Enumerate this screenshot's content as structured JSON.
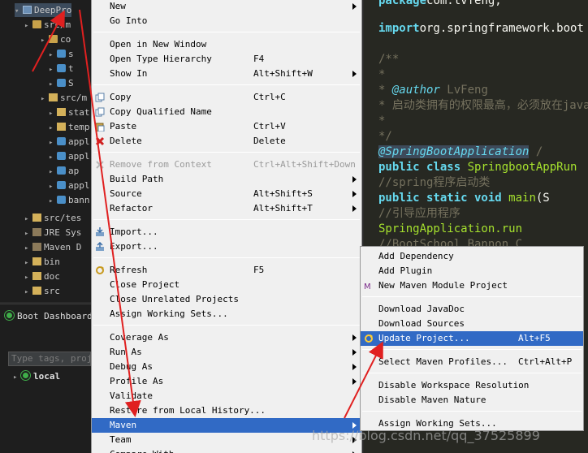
{
  "explorer": {
    "project": "DeepPro",
    "rows": [
      "src/m",
      "co",
      "s",
      "t",
      "S",
      "src/m",
      "stat",
      "temp",
      "appl",
      "appl",
      "ap",
      "appl",
      "bann",
      "src/tes",
      "JRE Sys",
      "Maven D",
      "bin",
      "doc",
      "src"
    ]
  },
  "boot_dashboard": {
    "title": "Boot Dashboard",
    "filter_placeholder": "Type tags, proje",
    "local": "local"
  },
  "editor": {
    "lines": [
      {
        "parts": [
          [
            "kw",
            "package"
          ],
          [
            "",
            "com.lvfeng;"
          ]
        ]
      },
      {
        "parts": [
          [
            "kw",
            "import"
          ],
          [
            "",
            "org.springframework.boot"
          ]
        ]
      },
      {
        "parts": [
          [
            "cm",
            "/**"
          ]
        ]
      },
      {
        "parts": [
          [
            "cm",
            "*"
          ]
        ]
      },
      {
        "parts": [
          [
            "cm",
            "* "
          ],
          [
            "an",
            "@author"
          ],
          [
            "cm",
            " LvFeng"
          ]
        ]
      },
      {
        "parts": [
          [
            "cm",
            "* 启动类拥有的权限最高，必须放在java包内"
          ]
        ]
      },
      {
        "parts": [
          [
            "cm",
            "*"
          ]
        ]
      },
      {
        "parts": [
          [
            "cm",
            "*/"
          ]
        ]
      },
      {
        "parts": [
          [
            "an",
            "@SpringBootApplication"
          ],
          [
            "cm",
            "       /"
          ]
        ]
      },
      {
        "parts": [
          [
            "kw",
            "public class "
          ],
          [
            "fn",
            "SpringbootAppRun"
          ]
        ]
      },
      {
        "parts": [
          [
            "cm",
            "//spring程序启动类"
          ]
        ]
      },
      {
        "parts": [
          [
            "",
            "    "
          ],
          [
            "kw",
            "public static void "
          ],
          [
            "fn",
            "main"
          ],
          [
            "",
            "(S"
          ]
        ]
      },
      {
        "parts": [
          [
            "cm",
            "        //引导应用程序"
          ]
        ]
      },
      {
        "parts": [
          [
            "",
            "        "
          ],
          [
            "fn",
            "SpringApplication.run"
          ]
        ]
      },
      {
        "parts": [
          [
            "cm",
            "        //BootSchool Bannon C"
          ]
        ]
      }
    ]
  },
  "context_menu": {
    "items": [
      {
        "label": "New",
        "sc": "",
        "sub": true
      },
      {
        "label": "Go Into",
        "sc": ""
      },
      {
        "sep": true
      },
      {
        "label": "Open in New Window",
        "sc": ""
      },
      {
        "label": "Open Type Hierarchy",
        "sc": "F4"
      },
      {
        "label": "Show In",
        "sc": "Alt+Shift+W",
        "sub": true
      },
      {
        "sep": true
      },
      {
        "label": "Copy",
        "sc": "Ctrl+C",
        "icon": "copy-icon"
      },
      {
        "label": "Copy Qualified Name",
        "sc": "",
        "icon": "copy-icon"
      },
      {
        "label": "Paste",
        "sc": "Ctrl+V",
        "icon": "paste-icon"
      },
      {
        "label": "Delete",
        "sc": "Delete",
        "icon": "delete-icon"
      },
      {
        "sep": true
      },
      {
        "label": "Remove from Context",
        "sc": "Ctrl+Alt+Shift+Down",
        "disabled": true,
        "icon": "remove-icon"
      },
      {
        "label": "Build Path",
        "sc": "",
        "sub": true
      },
      {
        "label": "Source",
        "sc": "Alt+Shift+S",
        "sub": true
      },
      {
        "label": "Refactor",
        "sc": "Alt+Shift+T",
        "sub": true
      },
      {
        "sep": true
      },
      {
        "label": "Import...",
        "sc": "",
        "icon": "import-icon"
      },
      {
        "label": "Export...",
        "sc": "",
        "icon": "export-icon"
      },
      {
        "sep": true
      },
      {
        "label": "Refresh",
        "sc": "F5",
        "icon": "refresh-icon"
      },
      {
        "label": "Close Project",
        "sc": ""
      },
      {
        "label": "Close Unrelated Projects",
        "sc": ""
      },
      {
        "label": "Assign Working Sets...",
        "sc": ""
      },
      {
        "sep": true
      },
      {
        "label": "Coverage As",
        "sc": "",
        "sub": true
      },
      {
        "label": "Run As",
        "sc": "",
        "sub": true
      },
      {
        "label": "Debug As",
        "sc": "",
        "sub": true
      },
      {
        "label": "Profile As",
        "sc": "",
        "sub": true
      },
      {
        "label": "Validate",
        "sc": ""
      },
      {
        "label": "Restore from Local History...",
        "sc": ""
      },
      {
        "label": "Maven",
        "sc": "",
        "sub": true,
        "highlight": true
      },
      {
        "label": "Team",
        "sc": "",
        "sub": true
      },
      {
        "label": "Compare With",
        "sc": "",
        "sub": true
      }
    ]
  },
  "maven_submenu": {
    "items": [
      {
        "label": "Add Dependency",
        "sc": ""
      },
      {
        "label": "Add Plugin",
        "sc": ""
      },
      {
        "label": "New Maven Module Project",
        "sc": "",
        "icon": "maven-icon"
      },
      {
        "sep": true
      },
      {
        "label": "Download JavaDoc",
        "sc": ""
      },
      {
        "label": "Download Sources",
        "sc": ""
      },
      {
        "label": "Update Project...",
        "sc": "Alt+F5",
        "highlight": true,
        "icon": "update-icon"
      },
      {
        "sep": true
      },
      {
        "label": "Select Maven Profiles...",
        "sc": "Ctrl+Alt+P"
      },
      {
        "sep": true
      },
      {
        "label": "Disable Workspace Resolution",
        "sc": ""
      },
      {
        "label": "Disable Maven Nature",
        "sc": ""
      },
      {
        "sep": true
      },
      {
        "label": "Assign Working Sets...",
        "sc": ""
      }
    ]
  },
  "watermark": "https://blog.csdn.net/qq_37525899",
  "colors": {
    "accent": "#316ac5",
    "arrow": "#e02020"
  }
}
